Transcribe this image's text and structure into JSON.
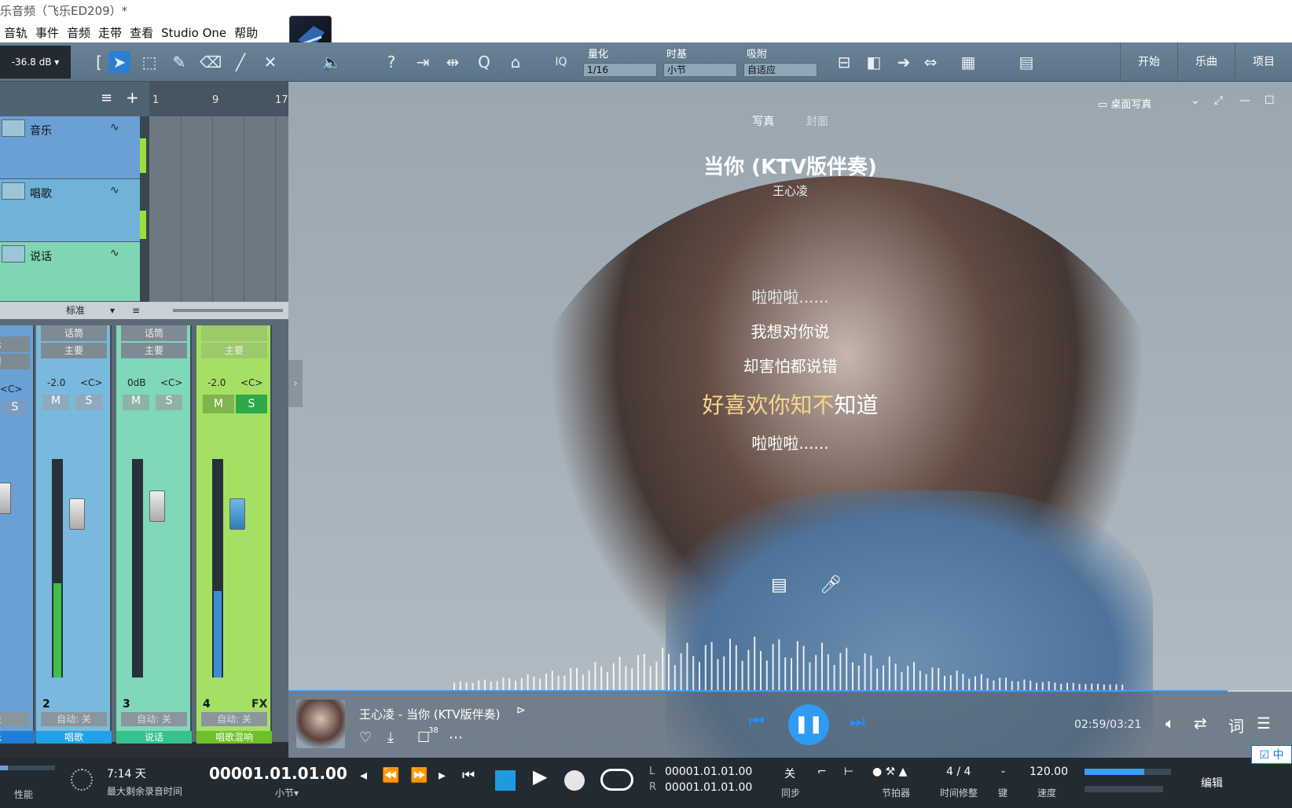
{
  "window": {
    "title": "乐音频（飞乐ED209）*"
  },
  "menu": {
    "items": [
      "音轨",
      "事件",
      "音频",
      "走带",
      "查看",
      "Studio One",
      "帮助"
    ]
  },
  "toolbar": {
    "volume": "-36.8 dB",
    "quantize": {
      "label": "量化",
      "value": "1/16"
    },
    "timebase": {
      "label": "时基",
      "value": "小节"
    },
    "snap": {
      "label": "吸附",
      "value": "自适应"
    },
    "iq": "IQ",
    "right_tabs": [
      "开始",
      "乐曲",
      "项目"
    ]
  },
  "arrange": {
    "ruler": [
      "1",
      "9",
      "17"
    ],
    "tracks": [
      {
        "name": "音乐",
        "color": "#6aa0d6"
      },
      {
        "name": "唱歌",
        "color": "#70b3d9"
      },
      {
        "name": "说话",
        "color": "#7ed6b3"
      }
    ]
  },
  "mixer": {
    "bar_label": "标准",
    "channels": [
      {
        "in": "乐",
        "out": "要",
        "vol": "",
        "pan": "<C>",
        "mute": "",
        "solo": "S",
        "num": "",
        "auto": "关",
        "name": "乐",
        "color": "#6aa0d6"
      },
      {
        "in": "话筒",
        "out": "主要",
        "vol": "-2.0",
        "pan": "<C>",
        "mute": "M",
        "solo": "S",
        "num": "2",
        "auto": "自动: 关",
        "name": "唱歌",
        "color": "#7ab9de"
      },
      {
        "in": "话筒",
        "out": "主要",
        "vol": "0dB",
        "pan": "<C>",
        "mute": "M",
        "solo": "S",
        "num": "3",
        "auto": "自动: 关",
        "name": "说话",
        "color": "#7fd8b8"
      },
      {
        "in": "",
        "out": "主要",
        "vol": "-2.0",
        "pan": "<C>",
        "mute": "M",
        "solo": "S",
        "num": "4",
        "fx": "FX",
        "auto": "自动: 关",
        "name": "唱歌混响",
        "color": "#a5e065"
      }
    ],
    "scale": [
      "10",
      "0",
      "-3",
      "-6",
      "-12",
      "-24",
      "-36",
      "-48",
      "-60",
      "-72"
    ]
  },
  "player": {
    "tab_active": "写真",
    "tab_inactive": "封面",
    "desk_mode": "桌面写真",
    "song_title": "当你 (KTV版伴奏)",
    "artist": "王心凌",
    "lyrics_prev2": "啦啦啦......",
    "lyrics_prev1": "我想对你说",
    "lyrics_prev0": "却害怕都说错",
    "lyric_current_sung": "好喜欢你知不",
    "lyric_current_rest": "知道",
    "lyrics_next": "啦啦啦......",
    "now_playing": "王心凌 - 当你 (KTV版伴奏)",
    "comment_count": "38",
    "time": "02:59/03:21",
    "progress": 0.936,
    "lyric_btn": "词"
  },
  "transport": {
    "perf_label": "性能",
    "record_time": "7:14 天",
    "record_label": "最大剩余录音时间",
    "position": "00001.01.01.00",
    "position_unit": "小节",
    "left_loc": "00001.01.01.00",
    "right_loc": "00001.01.01.00",
    "L": "L",
    "R": "R",
    "sync_off": "关",
    "sync_label": "同步",
    "metronome_label": "节拍器",
    "timesig": "4 / 4",
    "timesig_label": "时间修整",
    "key": "-",
    "key_label": "键",
    "tempo": "120.00",
    "tempo_label": "速度",
    "edit": "编辑",
    "ime": "中"
  }
}
